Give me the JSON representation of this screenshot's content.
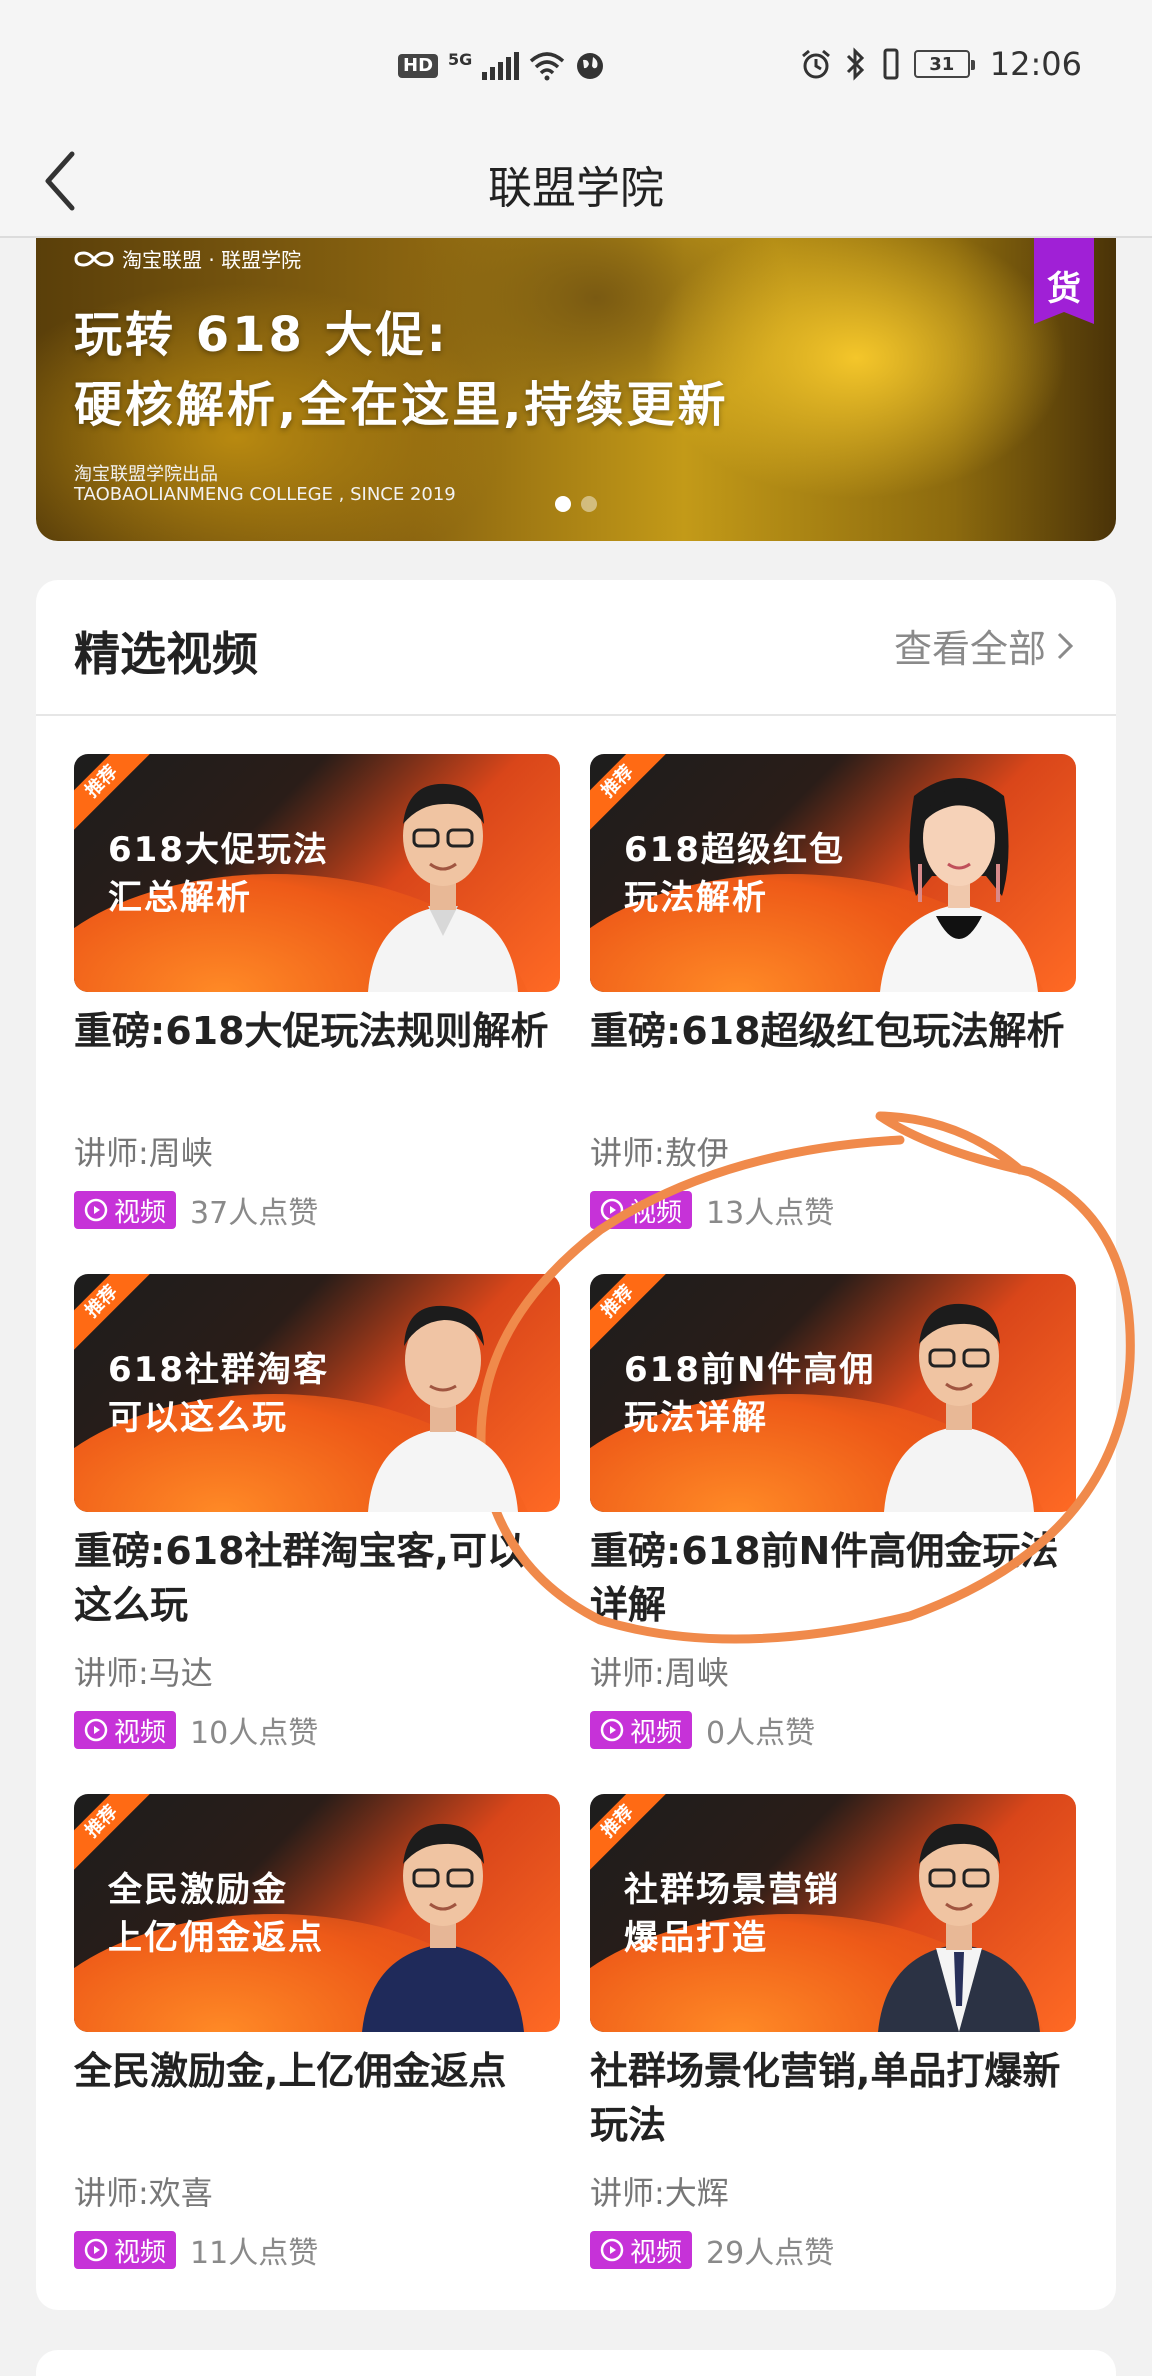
{
  "status_bar": {
    "hd": "HD",
    "network": "5G",
    "battery": "31",
    "time": "12:06"
  },
  "nav": {
    "title": "联盟学院",
    "back_icon": "chevron-left-icon"
  },
  "banner": {
    "brand": "淘宝联盟 · 联盟学院",
    "title_line1": "玩转 618 大促:",
    "title_line2": "硬核解析,全在这里,持续更新",
    "sub_line1": "淘宝联盟学院出品",
    "sub_line2": "TAOBAOLIANMENG COLLEGE , SINCE 2019",
    "ribbon": "货",
    "dots": 2,
    "active_dot": 0
  },
  "section": {
    "title": "精选视频",
    "view_all": "查看全部"
  },
  "videos": [
    {
      "tag": "推荐",
      "thumb_line1": "618大促玩法",
      "thumb_line2": "汇总解析",
      "title": "重磅:618大促玩法规则解析",
      "instructor": "讲师:周峡",
      "badge": "视频",
      "likes": "37人点赞"
    },
    {
      "tag": "推荐",
      "thumb_line1": "618超级红包",
      "thumb_line2": "玩法解析",
      "title": "重磅:618超级红包玩法解析",
      "instructor": "讲师:敖伊",
      "badge": "视频",
      "likes": "13人点赞"
    },
    {
      "tag": "推荐",
      "thumb_line1": "618社群淘客",
      "thumb_line2": "可以这么玩",
      "title": "重磅:618社群淘宝客,可以这么玩",
      "instructor": "讲师:马达",
      "badge": "视频",
      "likes": "10人点赞"
    },
    {
      "tag": "推荐",
      "thumb_line1": "618前N件高佣",
      "thumb_line2": "玩法详解",
      "title": "重磅:618前N件高佣金玩法详解",
      "instructor": "讲师:周峡",
      "badge": "视频",
      "likes": "0人点赞"
    },
    {
      "tag": "推荐",
      "thumb_line1": "全民激励金",
      "thumb_line2": "上亿佣金返点",
      "title": "全民激励金,上亿佣金返点",
      "instructor": "讲师:欢喜",
      "badge": "视频",
      "likes": "11人点赞"
    },
    {
      "tag": "推荐",
      "thumb_line1": "社群场景营销",
      "thumb_line2": "爆品打造",
      "title": "社群场景化营销,单品打爆新玩法",
      "instructor": "讲师:大辉",
      "badge": "视频",
      "likes": "29人点赞"
    }
  ],
  "colors": {
    "badge": "#c632d8",
    "annotation": "#f08a4b",
    "ribbon": "#a020d6"
  }
}
